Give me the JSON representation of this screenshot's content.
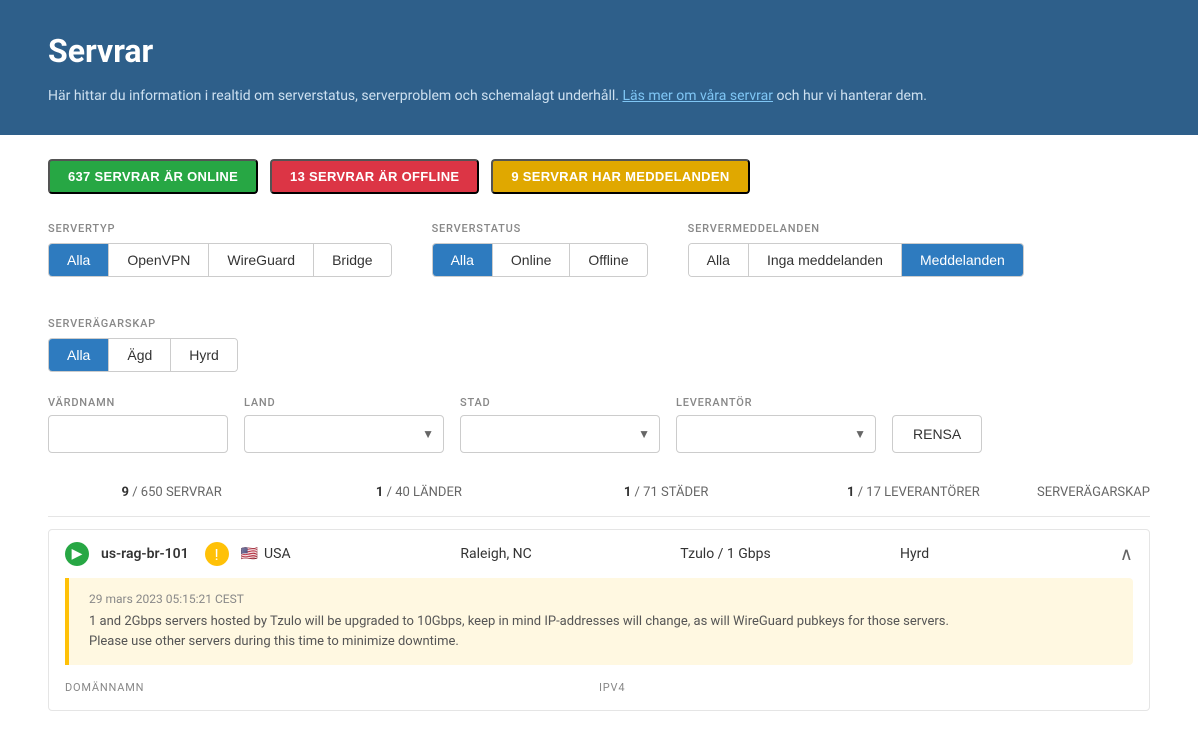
{
  "header": {
    "title": "Servrar",
    "description": "Här hittar du information i realtid om serverstatus, serverproblem och schemalagt underhåll.",
    "link_text": "Läs mer om våra servrar",
    "description_suffix": " och hur vi hanterar dem."
  },
  "status_badges": {
    "online": "637 SERVRAR ÄR ONLINE",
    "offline": "13 SERVRAR ÄR OFFLINE",
    "messages": "9 SERVRAR HAR MEDDELANDEN"
  },
  "filters": {
    "server_type": {
      "label": "SERVERTYP",
      "options": [
        "Alla",
        "OpenVPN",
        "WireGuard",
        "Bridge"
      ],
      "active": "Alla"
    },
    "server_status": {
      "label": "SERVERSTATUS",
      "options": [
        "Alla",
        "Online",
        "Offline"
      ],
      "active": "Alla"
    },
    "server_messages": {
      "label": "SERVERMEDDELANDEN",
      "options": [
        "Alla",
        "Inga meddelanden",
        "Meddelanden"
      ],
      "active": "Meddelanden"
    },
    "server_ownership": {
      "label": "SERVERÄGARSKAP",
      "options": [
        "Alla",
        "Ägd",
        "Hyrd"
      ],
      "active": "Alla"
    }
  },
  "search": {
    "hostname_label": "VÄRDNAMN",
    "hostname_placeholder": "",
    "country_label": "LAND",
    "country_placeholder": "",
    "city_label": "STAD",
    "city_placeholder": "",
    "provider_label": "LEVERANTÖR",
    "provider_placeholder": "",
    "clear_button": "RENSA"
  },
  "stats": {
    "servers": "9",
    "servers_total": "650",
    "servers_label": "SERVRAR",
    "countries": "1",
    "countries_total": "40",
    "countries_label": "LÄNDER",
    "cities": "1",
    "cities_total": "71",
    "cities_label": "STÄDER",
    "providers": "1",
    "providers_total": "17",
    "providers_label": "LEVERANTÖRER",
    "ownership_label": "SERVERÄGARSKAP"
  },
  "server": {
    "name": "us-rag-br-101",
    "country_flag": "🇺🇸",
    "country": "USA",
    "city": "Raleigh, NC",
    "provider": "Tzulo / 1 Gbps",
    "ownership": "Hyrd",
    "alert": {
      "date": "29 mars 2023 05:15:21 CEST",
      "text": "1 and 2Gbps servers hosted by Tzulo will be upgraded to 10Gbps, keep in mind IP-addresses will change, as will WireGuard pubkeys for those servers.\nPlease use other servers during this time to minimize downtime."
    },
    "domain_label": "DOMÄNNAMN",
    "ipv4_label": "IPV4"
  }
}
